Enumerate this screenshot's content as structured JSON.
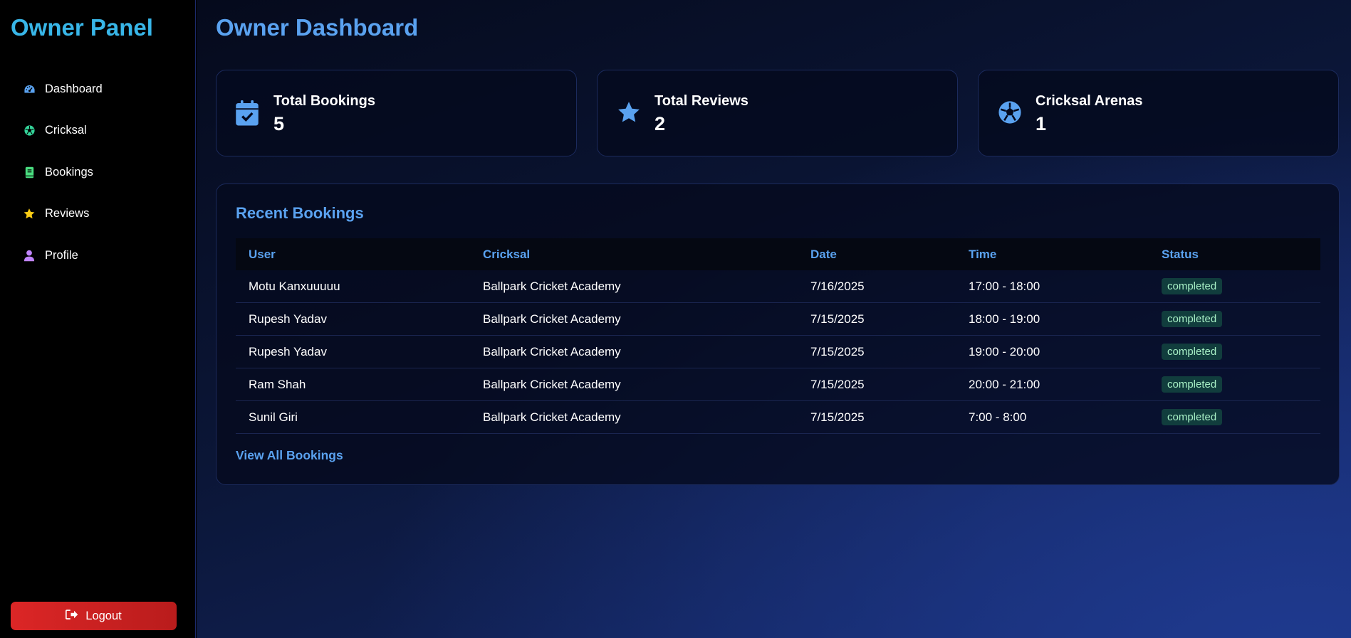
{
  "sidebar": {
    "title": "Owner Panel",
    "items": [
      {
        "label": "Dashboard",
        "icon": "gauge-icon",
        "color": "#5aa2f0"
      },
      {
        "label": "Cricksal",
        "icon": "soccer-ball-icon",
        "color": "#34d399"
      },
      {
        "label": "Bookings",
        "icon": "book-icon",
        "color": "#4ade80"
      },
      {
        "label": "Reviews",
        "icon": "star-icon",
        "color": "#facc15"
      },
      {
        "label": "Profile",
        "icon": "user-icon",
        "color": "#c084fc"
      }
    ],
    "logout_label": "Logout"
  },
  "main": {
    "title": "Owner Dashboard",
    "cards": [
      {
        "label": "Total Bookings",
        "value": "5",
        "icon": "calendar-check-icon"
      },
      {
        "label": "Total Reviews",
        "value": "2",
        "icon": "star-icon"
      },
      {
        "label": "Cricksal Arenas",
        "value": "1",
        "icon": "soccer-ball-icon"
      }
    ],
    "recent": {
      "title": "Recent Bookings",
      "columns": [
        "User",
        "Cricksal",
        "Date",
        "Time",
        "Status"
      ],
      "rows": [
        {
          "user": "Motu Kanxuuuuu",
          "cricksal": "Ballpark Cricket Academy",
          "date": "7/16/2025",
          "time": "17:00 - 18:00",
          "status": "completed"
        },
        {
          "user": "Rupesh Yadav",
          "cricksal": "Ballpark Cricket Academy",
          "date": "7/15/2025",
          "time": "18:00 - 19:00",
          "status": "completed"
        },
        {
          "user": "Rupesh Yadav",
          "cricksal": "Ballpark Cricket Academy",
          "date": "7/15/2025",
          "time": "19:00 - 20:00",
          "status": "completed"
        },
        {
          "user": "Ram Shah",
          "cricksal": "Ballpark Cricket Academy",
          "date": "7/15/2025",
          "time": "20:00 - 21:00",
          "status": "completed"
        },
        {
          "user": "Sunil Giri",
          "cricksal": "Ballpark Cricket Academy",
          "date": "7/15/2025",
          "time": "7:00 - 8:00",
          "status": "completed"
        }
      ],
      "view_all_label": "View All Bookings"
    }
  },
  "colors": {
    "accent": "#5aa2f0",
    "brand": "#38b6e8",
    "logout": "#dc2626",
    "status_completed_bg": "#113d3d",
    "status_completed_text": "#a8f0c6"
  }
}
